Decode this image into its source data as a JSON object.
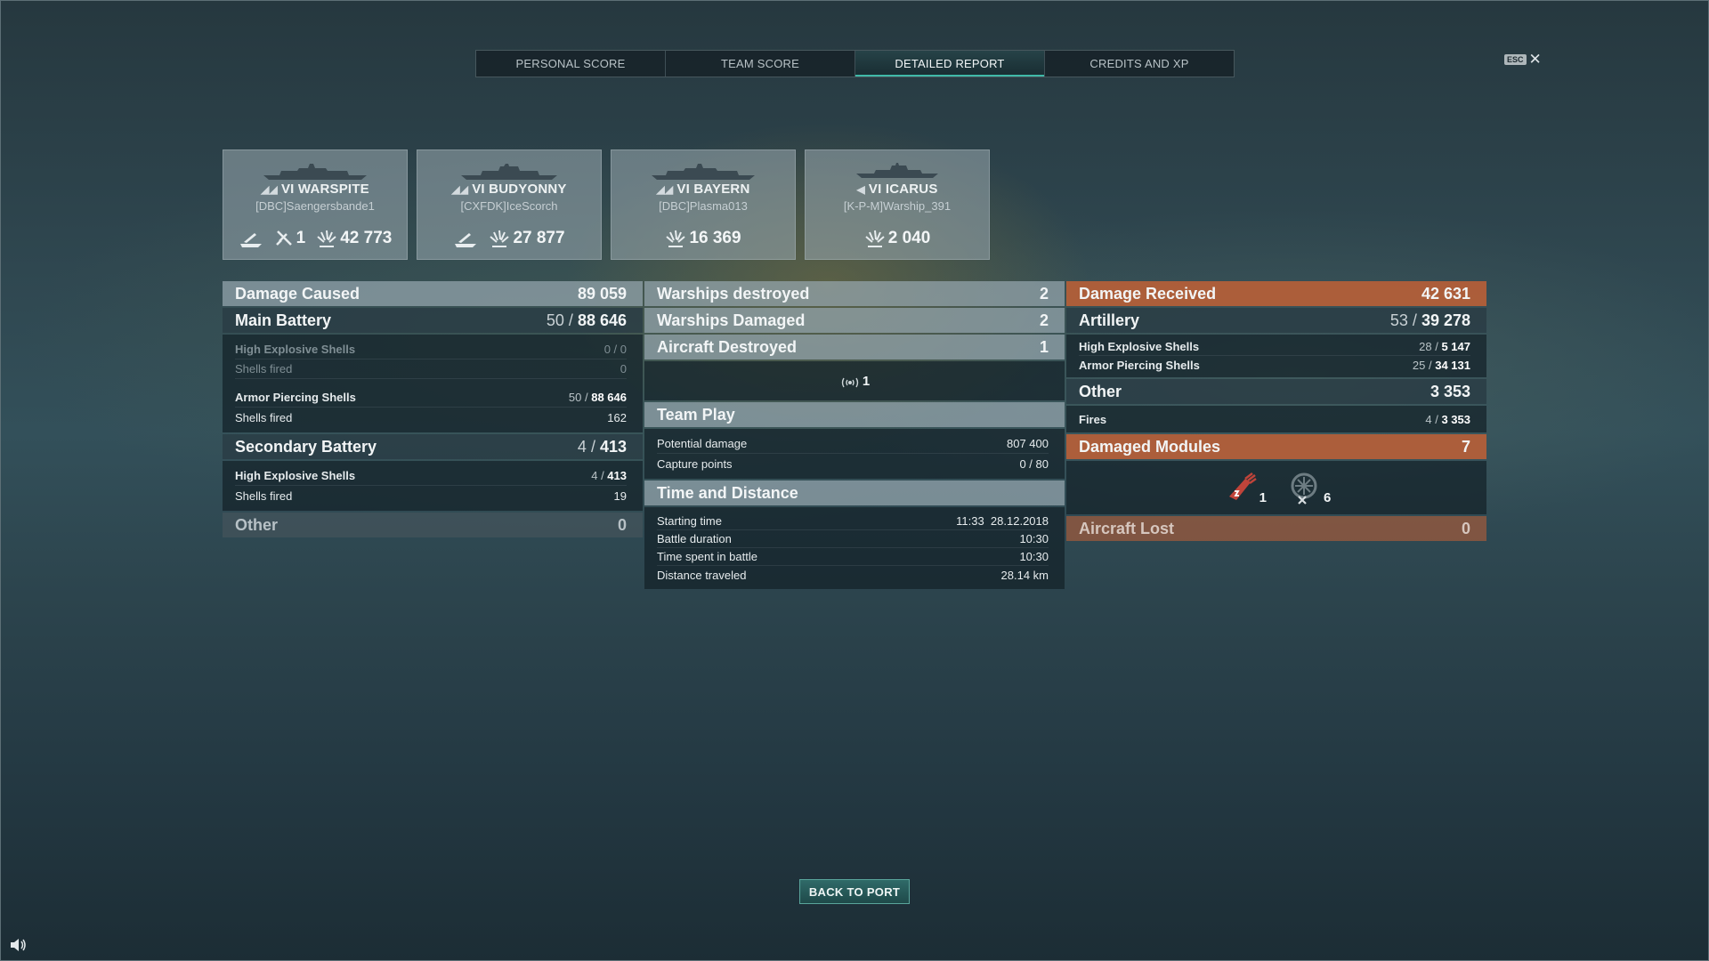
{
  "tabs": [
    {
      "label": "PERSONAL SCORE"
    },
    {
      "label": "TEAM SCORE"
    },
    {
      "label": "DETAILED REPORT",
      "active": true
    },
    {
      "label": "CREDITS AND XP"
    }
  ],
  "esc": {
    "key": "ESC",
    "close": "✕"
  },
  "ships": [
    {
      "cls": "VI",
      "name": "WARSPITE",
      "player": "[DBC]Saengersbande1",
      "stats": {
        "torp": "",
        "planes": "1",
        "damage": "42 773"
      },
      "icon_type": "battleship"
    },
    {
      "cls": "VI",
      "name": "BUDYONNY",
      "player": "[CXFDK]IceScorch",
      "stats": {
        "torp": "",
        "damage": "27 877"
      },
      "icon_type": "cruiser"
    },
    {
      "cls": "VI",
      "name": "BAYERN",
      "player": "[DBC]Plasma013",
      "stats": {
        "damage": "16 369"
      },
      "icon_type": "battleship"
    },
    {
      "cls": "VI",
      "name": "ICARUS",
      "player": "[K-P-M]Warship_391",
      "stats": {
        "damage": "2 040"
      },
      "icon_type": "destroyer"
    }
  ],
  "damage_caused": {
    "title": "Damage Caused",
    "value": "89 059",
    "main_battery": {
      "title": "Main Battery",
      "hits": "50",
      "damage": "88 646",
      "rows": [
        {
          "label": "High Explosive Shells",
          "value": "0 / 0",
          "dim": true
        },
        {
          "label": "Shells fired",
          "value": "0",
          "dim": true
        },
        {
          "label": "Armor Piercing Shells",
          "hits": "50",
          "damage": "88 646"
        },
        {
          "label": "Shells fired",
          "value": "162"
        }
      ]
    },
    "secondary": {
      "title": "Secondary Battery",
      "hits": "4",
      "damage": "413",
      "rows": [
        {
          "label": "High Explosive Shells",
          "hits": "4",
          "damage": "413"
        },
        {
          "label": "Shells fired",
          "value": "19"
        }
      ]
    },
    "other": {
      "title": "Other",
      "value": "0"
    }
  },
  "middle": {
    "warships_destroyed": {
      "title": "Warships destroyed",
      "value": "2"
    },
    "warships_damaged": {
      "title": "Warships Damaged",
      "value": "2"
    },
    "aircraft_destroyed": {
      "title": "Aircraft Destroyed",
      "value": "1",
      "icon_count": "1"
    },
    "team_play": {
      "title": "Team Play",
      "rows": [
        {
          "label": "Potential damage",
          "value": "807 400"
        },
        {
          "label": "Capture points",
          "value": "0 / 80"
        }
      ]
    },
    "time_distance": {
      "title": "Time and Distance",
      "rows": [
        {
          "label": "Starting time",
          "value": "11:33  28.12.2018"
        },
        {
          "label": "Battle duration",
          "value": "10:30"
        },
        {
          "label": "Time spent in battle",
          "value": "10:30"
        },
        {
          "label": "Distance traveled",
          "value": "28.14 km"
        }
      ]
    }
  },
  "damage_received": {
    "title": "Damage Received",
    "value": "42 631",
    "artillery": {
      "title": "Artillery",
      "hits": "53",
      "damage": "39 278",
      "rows": [
        {
          "label": "High Explosive Shells",
          "hits": "28",
          "damage": "5 147"
        },
        {
          "label": "Armor Piercing Shells",
          "hits": "25",
          "damage": "34 131"
        }
      ]
    },
    "other": {
      "title": "Other",
      "value": "3 353",
      "rows": [
        {
          "label": "Fires",
          "hits": "4",
          "damage": "3 353"
        }
      ]
    },
    "damaged_modules": {
      "title": "Damaged Modules",
      "value": "7",
      "items": [
        {
          "icon": "damaged-gun-icon",
          "count": "1"
        },
        {
          "icon": "destroyed-module-icon",
          "count": "6"
        }
      ]
    },
    "aircraft_lost": {
      "title": "Aircraft Lost",
      "value": "0"
    }
  },
  "back_button": "BACK TO PORT",
  "colors": {
    "accent": "#3fb9a8",
    "received": "#b95f37",
    "header": "#96a6ae"
  }
}
